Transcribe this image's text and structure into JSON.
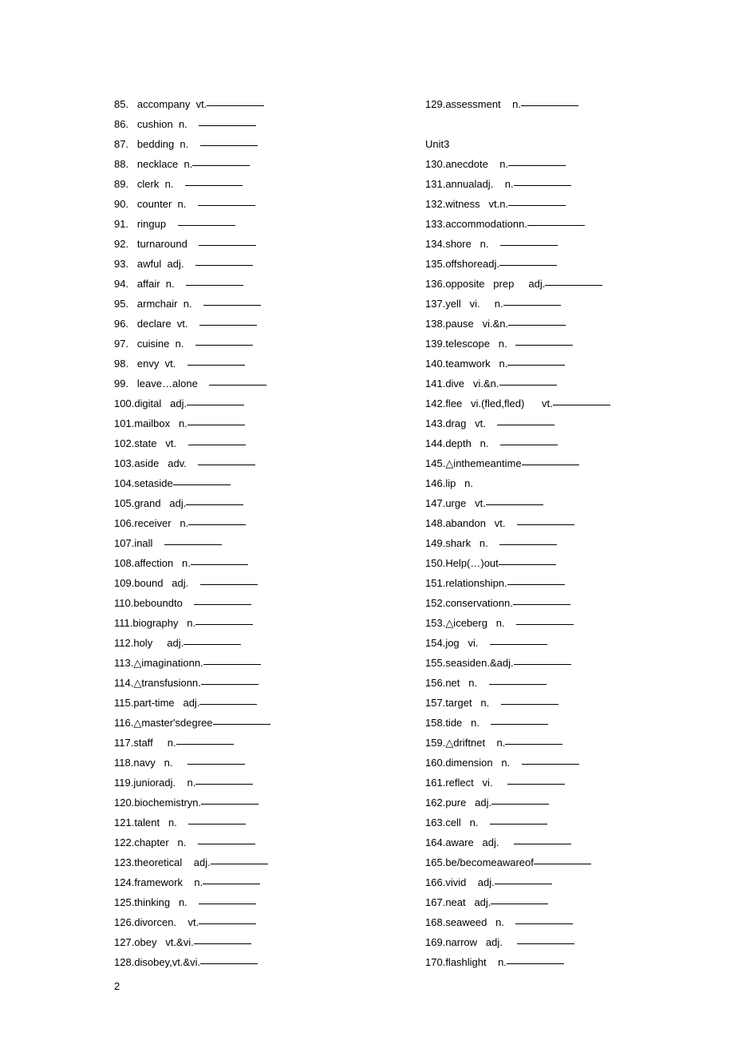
{
  "page_number": "2",
  "unit_header": "Unit3",
  "left": [
    {
      "n": "85.",
      "t": "accompany  vt."
    },
    {
      "n": "86.",
      "t": "cushion  n.    "
    },
    {
      "n": "87.",
      "t": "bedding  n.    "
    },
    {
      "n": "88.",
      "t": "necklace  n."
    },
    {
      "n": "89.",
      "t": "clerk  n.    "
    },
    {
      "n": "90.",
      "t": "counter  n.    "
    },
    {
      "n": "91.",
      "t": "ringup    "
    },
    {
      "n": "92.",
      "t": "turnaround    "
    },
    {
      "n": "93.",
      "t": "awful  adj.    "
    },
    {
      "n": "94.",
      "t": "affair  n.    "
    },
    {
      "n": "95.",
      "t": "armchair  n.    "
    },
    {
      "n": "96.",
      "t": "declare  vt.    "
    },
    {
      "n": "97.",
      "t": "cuisine  n.    "
    },
    {
      "n": "98.",
      "t": "envy  vt.    "
    },
    {
      "n": "99.",
      "t": "leave…alone    "
    },
    {
      "n": "100.",
      "t": "digital   adj."
    },
    {
      "n": "101.",
      "t": "mailbox   n."
    },
    {
      "n": "102.",
      "t": "state   vt.    "
    },
    {
      "n": "103.",
      "t": "aside   adv.    "
    },
    {
      "n": "104.",
      "t": "setaside"
    },
    {
      "n": "105.",
      "t": "grand   adj."
    },
    {
      "n": "106.",
      "t": "receiver   n."
    },
    {
      "n": "107.",
      "t": "inall    "
    },
    {
      "n": "108.",
      "t": "affection   n."
    },
    {
      "n": "109.",
      "t": "bound   adj.    "
    },
    {
      "n": "110.",
      "t": "beboundto    "
    },
    {
      "n": "111.",
      "t": "biography   n."
    },
    {
      "n": "112.",
      "t": "holy     adj."
    },
    {
      "n": "113.",
      "t": "△imaginationn."
    },
    {
      "n": "114.",
      "t": "△transfusionn."
    },
    {
      "n": "115.",
      "t": "part-time   adj."
    },
    {
      "n": "116.",
      "t": "△master'sdegree"
    },
    {
      "n": "117.",
      "t": "staff     n."
    },
    {
      "n": "118.",
      "t": "navy   n.     "
    },
    {
      "n": "119.",
      "t": "junioradj.    n."
    },
    {
      "n": "120.",
      "t": "biochemistryn."
    },
    {
      "n": "121.",
      "t": "talent   n.    "
    },
    {
      "n": "122.",
      "t": "chapter   n.    "
    },
    {
      "n": "123.",
      "t": "theoretical    adj."
    },
    {
      "n": "124.",
      "t": "framework    n."
    },
    {
      "n": "125.",
      "t": "thinking   n.    "
    },
    {
      "n": "126.",
      "t": "divorcen.    vt."
    },
    {
      "n": "127.",
      "t": "obey   vt.&vi."
    },
    {
      "n": "128.",
      "t": "disobey,vt.&vi."
    }
  ],
  "right_top": [
    {
      "n": "129.",
      "t": "assessment    n."
    }
  ],
  "right": [
    {
      "n": "130.",
      "t": "anecdote    n."
    },
    {
      "n": "131.",
      "t": "annualadj.    n."
    },
    {
      "n": "132.",
      "t": "witness   vt.n."
    },
    {
      "n": "133.",
      "t": "accommodationn."
    },
    {
      "n": "134.",
      "t": "shore   n.    "
    },
    {
      "n": "135.",
      "t": "offshoreadj."
    },
    {
      "n": "136.",
      "t": "opposite   prep     adj."
    },
    {
      "n": "137.",
      "t": "yell   vi.     n."
    },
    {
      "n": "138.",
      "t": "pause   vi.&n."
    },
    {
      "n": "139.",
      "t": "telescope   n.   "
    },
    {
      "n": "140.",
      "t": "teamwork   n."
    },
    {
      "n": "141.",
      "t": "dive   vi.&n."
    },
    {
      "n": "142.",
      "t": "flee   vi.(fled,fled)      vt."
    },
    {
      "n": "143.",
      "t": "drag   vt.    "
    },
    {
      "n": "144.",
      "t": "depth   n.    "
    },
    {
      "n": "145.",
      "t": "△inthemeantime"
    },
    {
      "n": "146.",
      "t": "lip   n.",
      "noblank": true
    },
    {
      "n": "147.",
      "t": "urge   vt."
    },
    {
      "n": "148.",
      "t": "abandon   vt.    "
    },
    {
      "n": "149.",
      "t": "shark   n.    "
    },
    {
      "n": "150.",
      "t": "Help(…)out"
    },
    {
      "n": "151.",
      "t": "relationshipn."
    },
    {
      "n": "152.",
      "t": "conservationn."
    },
    {
      "n": "153.",
      "t": "△iceberg   n.    "
    },
    {
      "n": "154.",
      "t": "jog   vi.    "
    },
    {
      "n": "155.",
      "t": "seasiden.&adj."
    },
    {
      "n": "156.",
      "t": "net   n.    "
    },
    {
      "n": "157.",
      "t": "target   n.    "
    },
    {
      "n": "158.",
      "t": "tide   n.    "
    },
    {
      "n": "159.",
      "t": "△driftnet    n."
    },
    {
      "n": "160.",
      "t": "dimension   n.    "
    },
    {
      "n": "161.",
      "t": "reflect   vi.     "
    },
    {
      "n": "162.",
      "t": "pure   adj."
    },
    {
      "n": "163.",
      "t": "cell   n.    "
    },
    {
      "n": "164.",
      "t": "aware   adj.     "
    },
    {
      "n": "165.",
      "t": "be/becomeawareof"
    },
    {
      "n": "166.",
      "t": "vivid    adj."
    },
    {
      "n": "167.",
      "t": "neat   adj."
    },
    {
      "n": "168.",
      "t": "seaweed   n.    "
    },
    {
      "n": "169.",
      "t": "narrow   adj.     "
    },
    {
      "n": "170.",
      "t": "flashlight    n."
    }
  ]
}
